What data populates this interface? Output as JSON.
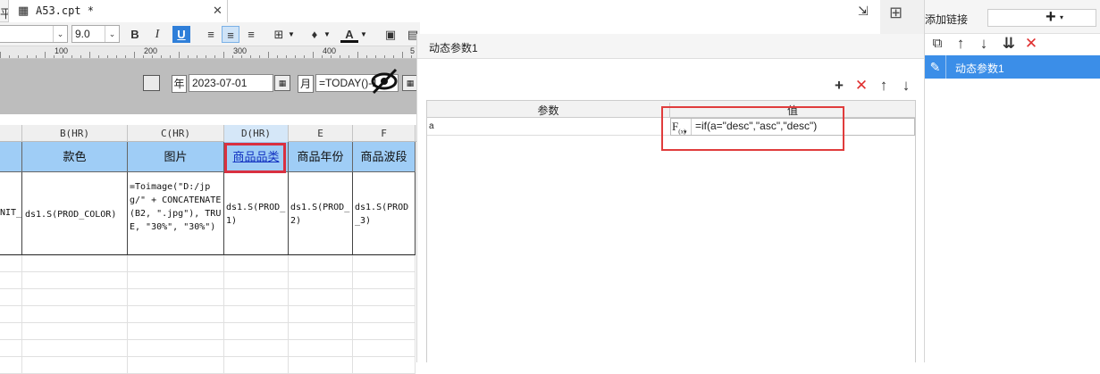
{
  "tab": {
    "icon_glyph": "平",
    "doc_glyph": "▦",
    "title": "A53.cpt *",
    "close": "✕"
  },
  "toolbar": {
    "font_size": "9.0",
    "bold": "B",
    "italic": "I",
    "underline": "U",
    "font_color": "A"
  },
  "ruler": {
    "labels": [
      "100",
      "200",
      "300",
      "400",
      "5"
    ]
  },
  "params": {
    "year_label": "年",
    "date_value": "2023-07-01",
    "month_label": "月",
    "today_value": "=TODAY()-1"
  },
  "columns": {
    "headers": [
      "B(HR)",
      "C(HR)",
      "D(HR)",
      "E",
      "F"
    ]
  },
  "header_row": {
    "cells": [
      "款色",
      "图片",
      "商品品类",
      "商品年份",
      "商品波段"
    ]
  },
  "data_row": {
    "prefix": "NIT_",
    "cells": [
      "ds1.S(PROD_COLOR)",
      "=Toimage(\"D:/jpg/\" + CONCATENATE(B2, \".jpg\"), TRUE, \"30%\", \"30%\")",
      "ds1.S(PROD_1)",
      "ds1.S(PROD_2)",
      "ds1.S(PROD_3)"
    ]
  },
  "dialog": {
    "title": "动态参数1",
    "table_headers": {
      "param": "参数",
      "value": "值"
    },
    "rows": [
      {
        "param": "a",
        "value": "=if(a=\"desc\",\"asc\",\"desc\")"
      }
    ],
    "formula_icon": "F(x)"
  },
  "right_panel": {
    "title": "添加链接",
    "add": "+",
    "items": [
      "动态参数1"
    ]
  },
  "colors": {
    "accent": "#3b8ee8",
    "highlight_box": "#e03c3c",
    "header_fill": "#9fcdf6",
    "delete": "#e03030"
  }
}
